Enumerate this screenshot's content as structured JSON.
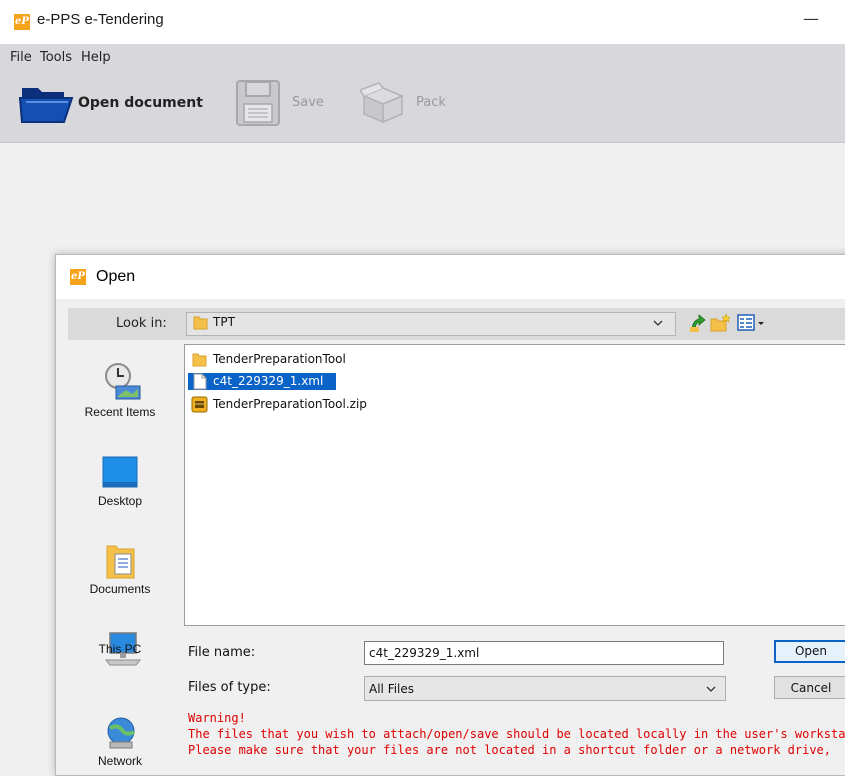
{
  "app": {
    "logo_text": "eP",
    "title": "e-PPS e-Tendering",
    "minimize_glyph": "—"
  },
  "menu": [
    "File",
    "Tools",
    "Help"
  ],
  "toolbar": {
    "open_label": "Open document",
    "save_label": "Save",
    "pack_label": "Pack"
  },
  "dialog": {
    "logo_text": "eP",
    "title": "Open",
    "look_in_label": "Look in:",
    "look_in_value": "TPT",
    "shortcuts": [
      {
        "label": "Recent Items",
        "icon": "recent-items-icon"
      },
      {
        "label": "Desktop",
        "icon": "desktop-icon"
      },
      {
        "label": "Documents",
        "icon": "documents-icon"
      },
      {
        "label": "This PC",
        "icon": "this-pc-icon"
      },
      {
        "label": "Network",
        "icon": "network-icon"
      }
    ],
    "files": [
      {
        "name": "TenderPreparationTool",
        "icon": "folder-icon",
        "selected": false
      },
      {
        "name": "c4t_229329_1.xml",
        "icon": "file-icon",
        "selected": true
      },
      {
        "name": "TenderPreparationTool.zip",
        "icon": "zip-icon",
        "selected": false
      }
    ],
    "file_name_label": "File name:",
    "file_name_value": "c4t_229329_1.xml",
    "files_of_type_label": "Files of type:",
    "files_of_type_value": "All Files",
    "open_button": "Open",
    "cancel_button": "Cancel",
    "warning": [
      "Warning!",
      "The files that you wish to attach/open/save should be located locally in the user's workstati",
      "Please make sure that your files are not located in a shortcut folder or a network drive,"
    ]
  },
  "colors": {
    "selection": "#0a64c8",
    "warning_text": "#e00000",
    "toolbar_bg": "#d8d8dc",
    "logo_orange": "#f7a21b"
  }
}
